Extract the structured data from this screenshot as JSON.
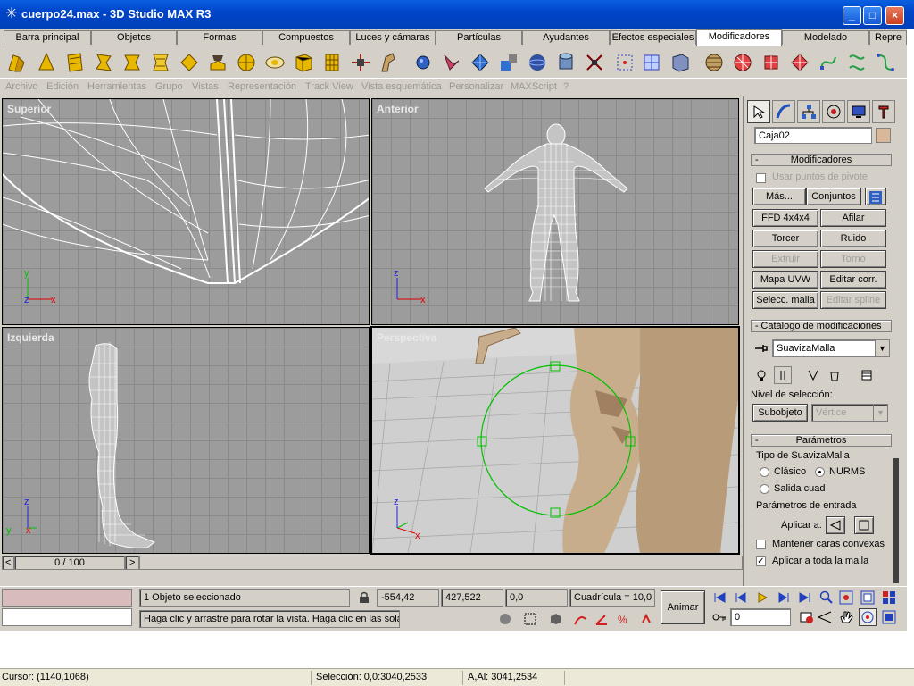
{
  "window": {
    "title": "cuerpo24.max - 3D Studio MAX R3",
    "min_label": "_",
    "max_label": "□",
    "close_label": "×"
  },
  "tabs": [
    {
      "label": "Barra principal"
    },
    {
      "label": "Objetos"
    },
    {
      "label": "Formas"
    },
    {
      "label": "Compuestos"
    },
    {
      "label": "Luces y cámaras"
    },
    {
      "label": "Partículas"
    },
    {
      "label": "Ayudantes"
    },
    {
      "label": "Efectos especiales"
    },
    {
      "label": "Modificadores"
    },
    {
      "label": "Modelado"
    },
    {
      "label": "Repre"
    }
  ],
  "active_tab": "Modificadores",
  "menu": [
    "Archivo",
    "Edición",
    "Herramientas",
    "Grupo",
    "Vistas",
    "Representación",
    "Track View",
    "Vista esquemática",
    "Personalizar",
    "MAXScript",
    "?"
  ],
  "viewports": {
    "top": {
      "label": "Superior"
    },
    "front": {
      "label": "Anterior"
    },
    "left": {
      "label": "Izquierda"
    },
    "perspective": {
      "label": "Perspectiva"
    },
    "axis_labels": {
      "y": "y",
      "x": "x",
      "z": "z"
    }
  },
  "panel": {
    "object_name": "Caja02",
    "object_color": "#d8b898",
    "modifiers_header": "Modificadores",
    "use_pivot_label": "Usar puntos de pivote",
    "more_label": "Más...",
    "sets_label": "Conjuntos",
    "buttons": [
      "FFD 4x4x4",
      "Afilar",
      "Torcer",
      "Ruido",
      "Extruir",
      "Torno",
      "Mapa UVW",
      "Editar corr.",
      "Selecc. malla",
      "Editar spline"
    ],
    "catalog_header": "Catálogo de modificaciones",
    "stack_value": "SuavizaMalla",
    "selection_level_label": "Nivel de selección:",
    "subobject_label": "Subobjeto",
    "vertex_label": "Vértice",
    "params_header": "Parámetros",
    "type_group_label": "Tipo de SuavizaMalla",
    "classic_label": "Clásico",
    "nurms_label": "NURMS",
    "quad_label": "Salida cuad",
    "input_group_label": "Parámetros de entrada",
    "apply_to_label": "Aplicar a:",
    "keep_convex_label": "Mantener caras convexas",
    "apply_whole_label": "Aplicar a toda la malla"
  },
  "timeline": {
    "frame": "0 / 100",
    "prev": "<",
    "next": ">"
  },
  "status": {
    "selected": "1 Objeto seleccionado",
    "prompt": "Haga clic y arrastre para rotar la vista. Haga clic en las solap",
    "x": "-554,42",
    "y": "427,522",
    "z": "0,0",
    "grid": "Cuadrícula = 10,0",
    "animate": "Animar",
    "frame_value": "0"
  },
  "app_status": {
    "cursor": "Cursor: (1140,1068)",
    "selection": "Selección: 0,0:3040,2533",
    "size": "A,Al: 3041,2534"
  },
  "colors": {
    "viewport_bg": "#9c9c9c",
    "wire": "#ffffff",
    "axis_x": "#e00000",
    "axis_y": "#00c000",
    "axis_z": "#2020e0",
    "gizmo": "#00c000",
    "skin": "#c8ad8c"
  }
}
